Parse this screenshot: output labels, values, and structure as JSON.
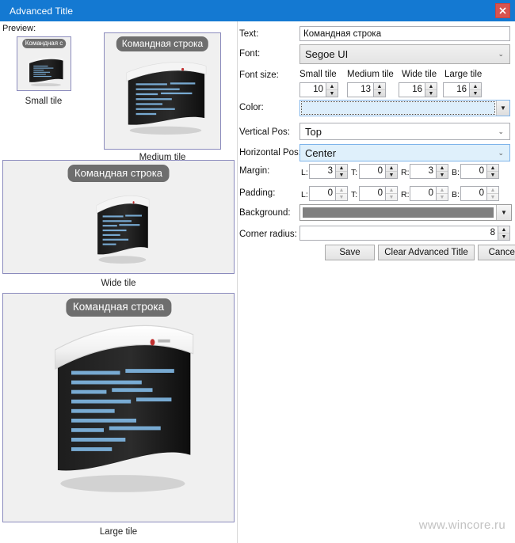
{
  "window": {
    "title": "Advanced Title",
    "close_label": "×",
    "titlebar_color": "#1479d2",
    "close_color": "#d9534f"
  },
  "preview": {
    "label": "Preview:",
    "tile_title": "Командная строка",
    "tile_title_small": "Командная с",
    "tiles": [
      {
        "caption": "Small tile"
      },
      {
        "caption": "Medium tile"
      },
      {
        "caption": "Wide tile"
      },
      {
        "caption": "Large tile"
      }
    ],
    "border_color": "#8b8bbd",
    "tile_bg": "#f0f0f0",
    "title_badge_color": "#6e6e6e"
  },
  "form": {
    "text": {
      "label": "Text:",
      "value": "Командная строка",
      "placeholder": ""
    },
    "font": {
      "label": "Font:",
      "value": "Segoe UI",
      "chevron": "⌄"
    },
    "font_size": {
      "label": "Font size:",
      "columns": [
        {
          "header": "Small tile",
          "value": "10"
        },
        {
          "header": "Medium tile",
          "value": "13"
        },
        {
          "header": "Wide tile",
          "value": "16"
        },
        {
          "header": "Large tile",
          "value": "16"
        }
      ]
    },
    "color": {
      "label": "Color:",
      "value": "",
      "swatch": "#ddeefb",
      "chevron": "▼"
    },
    "vertical_pos": {
      "label": "Vertical Pos:",
      "value": "Top",
      "chevron": "⌄"
    },
    "horizontal_pos": {
      "label": "Horizontal Pos:",
      "value": "Center",
      "chevron": "⌄"
    },
    "margin": {
      "label": "Margin:",
      "fields": [
        {
          "name": "L:",
          "value": "3"
        },
        {
          "name": "T:",
          "value": "0"
        },
        {
          "name": "R:",
          "value": "3"
        },
        {
          "name": "B:",
          "value": "0"
        }
      ]
    },
    "padding": {
      "label": "Padding:",
      "fields": [
        {
          "name": "L:",
          "value": "0"
        },
        {
          "name": "T:",
          "value": "0"
        },
        {
          "name": "R:",
          "value": "0"
        },
        {
          "name": "B:",
          "value": "0"
        }
      ]
    },
    "background": {
      "label": "Background:",
      "swatch": "#808080",
      "chevron": "▼"
    },
    "corner_radius": {
      "label": "Corner radius:",
      "value": "8"
    },
    "buttons": [
      {
        "name": "save",
        "label": "Save"
      },
      {
        "name": "clear",
        "label": "Clear Advanced Title"
      },
      {
        "name": "cancel",
        "label": "Cancel"
      }
    ],
    "spin_up": "▲",
    "spin_down": "▼"
  },
  "watermark": "www.wincore.ru"
}
